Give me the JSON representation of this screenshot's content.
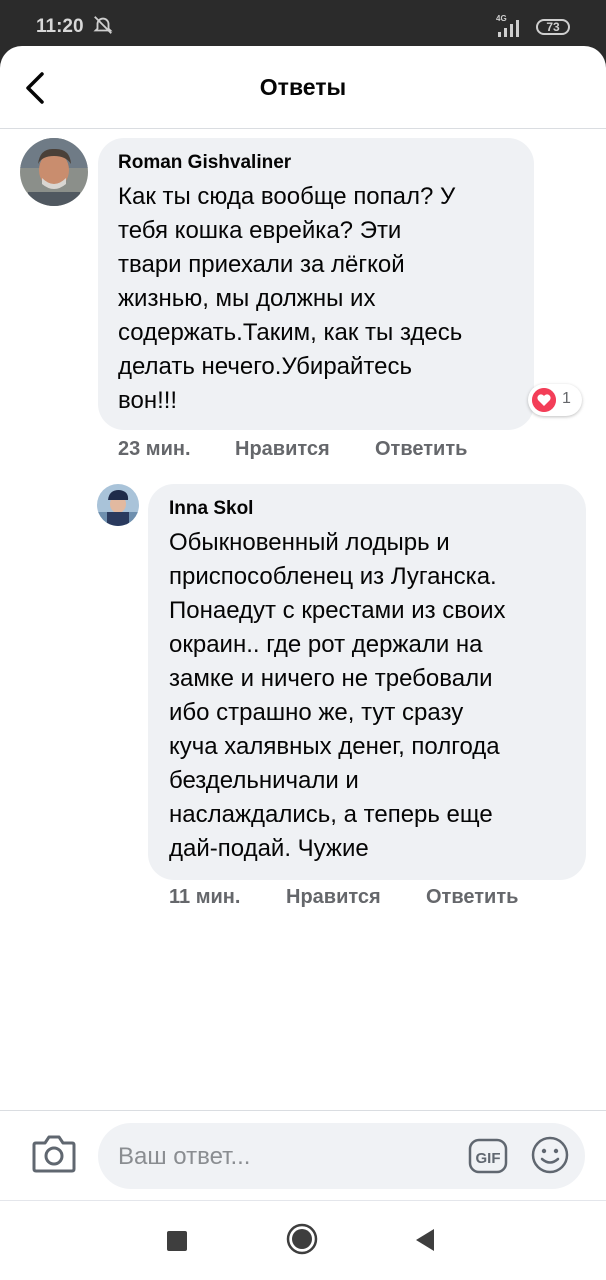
{
  "status_bar": {
    "time": "11:20",
    "network": "4G",
    "battery": "73"
  },
  "header": {
    "title": "Ответы"
  },
  "comments": [
    {
      "author": "Roman Gishvaliner",
      "lines": [
        "Как ты сюда вообще попал? У",
        "тебя кошка еврейка? Эти",
        "твари приехали за лёгкой",
        "жизнью, мы должны их",
        "содержать.Таким, как ты здесь",
        "делать нечего.Убирайтесь",
        "вон!!!"
      ],
      "time": "23 мин.",
      "like_label": "Нравится",
      "reply_label": "Ответить",
      "reaction_count": "1"
    },
    {
      "author": "Inna Skol",
      "lines": [
        "Обыкновенный лодырь и",
        "приспособленец из Луганска.",
        "Понаедут с крестами из своих",
        "окраин.. где рот держали на",
        "замке и ничего не требовали",
        "ибо страшно же,  тут сразу",
        "куча халявных денег, полгода",
        "бездельничали и",
        "наслаждались, а теперь еще",
        "дай-подай. Чужие"
      ],
      "time": "11 мин.",
      "like_label": "Нравится",
      "reply_label": "Ответить"
    }
  ],
  "composer": {
    "placeholder": "Ваш ответ...",
    "gif_label": "GIF"
  },
  "colors": {
    "bubble": "#eff1f4",
    "meta_text": "#65676b",
    "reaction_heart": "#f33e58"
  },
  "icons": [
    "mute-icon",
    "signal-icon",
    "battery-icon",
    "back-arrow-icon",
    "heart-reaction-icon",
    "camera-icon",
    "gif-icon",
    "emoji-icon",
    "nav-recents-icon",
    "nav-home-icon",
    "nav-back-icon"
  ]
}
